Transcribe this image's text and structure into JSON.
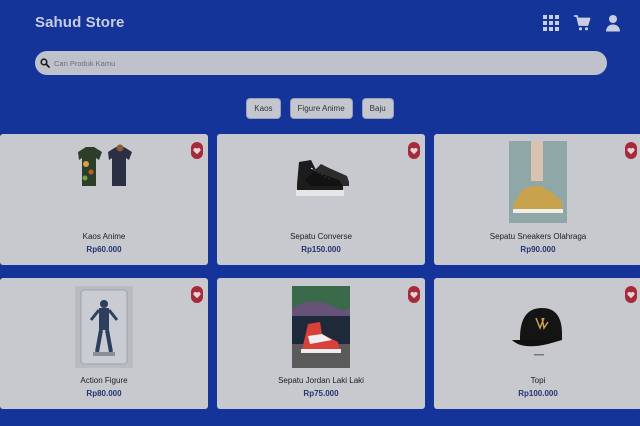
{
  "header": {
    "brand": "Sahud Store",
    "icons": [
      "grid-icon",
      "cart-icon",
      "user-icon"
    ]
  },
  "search": {
    "placeholder": "Cari Produk Kamu",
    "value": ""
  },
  "categories": [
    "Kaos",
    "Figure Anime",
    "Baju"
  ],
  "products": [
    {
      "name": "Kaos Anime",
      "price": "Rp60.000"
    },
    {
      "name": "Sepatu Converse",
      "price": "Rp150.000"
    },
    {
      "name": "Sepatu Sneakers Olahraga",
      "price": "Rp90.000"
    },
    {
      "name": "Action Figure",
      "price": "Rp80.000"
    },
    {
      "name": "Sepatu Jordan Laki Laki",
      "price": "Rp75.000"
    },
    {
      "name": "Topi",
      "price": "Rp100.000"
    }
  ],
  "colors": {
    "background": "#14349a",
    "card": "#c8c9cf",
    "favorite": "#a82a3a",
    "price": "#22356e"
  }
}
